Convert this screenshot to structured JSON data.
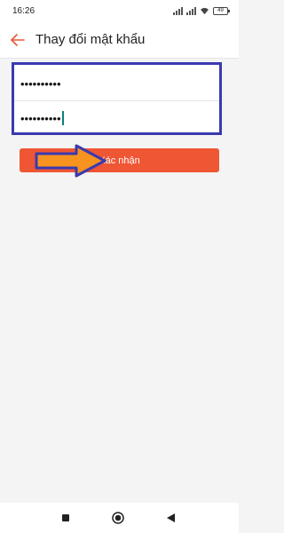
{
  "status_bar": {
    "time": "16:26",
    "battery": "49",
    "icons": [
      "signal-icon",
      "wifi-icon",
      "battery-icon"
    ]
  },
  "header": {
    "title": "Thay đổi mật khẩu",
    "back_icon": "arrow-left-icon"
  },
  "form": {
    "password_current_value": "••••••••••",
    "password_new_value": "••••••••••"
  },
  "confirm_button": {
    "label": "Xác nhận"
  },
  "colors": {
    "accent": "#ef5634",
    "highlight_box": "#3a3ab0",
    "arrow_fill": "#f7931e",
    "arrow_stroke": "#3a3ab0"
  },
  "nav_bar": {
    "icons": [
      "recent-apps-icon",
      "home-icon",
      "back-triangle-icon"
    ]
  }
}
